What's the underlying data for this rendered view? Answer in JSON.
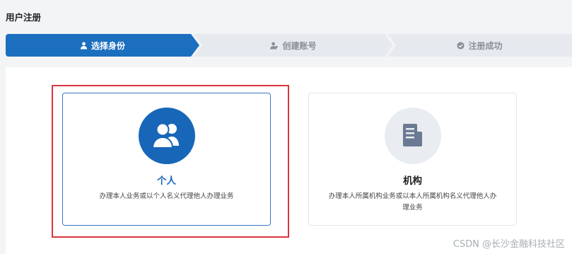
{
  "page": {
    "title": "用户注册"
  },
  "steps": [
    {
      "label": "选择身份",
      "icon": "user-icon",
      "active": true
    },
    {
      "label": "创建账号",
      "icon": "user-add-icon",
      "active": false
    },
    {
      "label": "注册成功",
      "icon": "check-circle-icon",
      "active": false
    }
  ],
  "cards": {
    "personal": {
      "title": "个人",
      "description": "办理本人业务或以个人名义代理他人办理业务",
      "icon": "users-icon",
      "selected": true
    },
    "organization": {
      "title": "机构",
      "description": "办理本人所属机构业务或以本人所属机构名义代理他人办理业务",
      "icon": "document-icon",
      "selected": false
    }
  },
  "watermark": "CSDN @长沙金融科技社区",
  "colors": {
    "primary": "#1766b8",
    "step_active": "#1c6fbf",
    "step_inactive": "#e6e9ee",
    "highlight": "#d9363e"
  }
}
